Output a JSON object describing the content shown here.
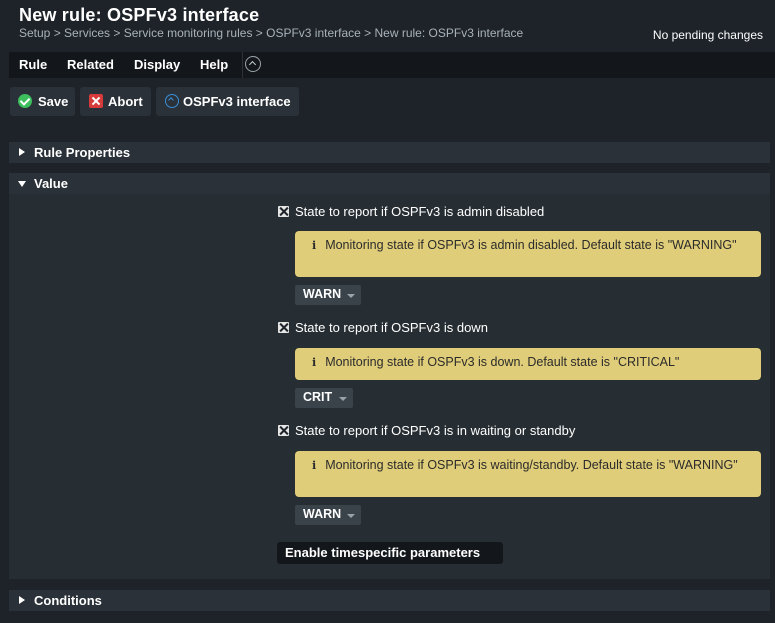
{
  "header": {
    "title": "New rule: OSPFv3 interface",
    "breadcrumb": "Setup > Services > Service monitoring rules > OSPFv3 interface > New rule: OSPFv3 interface",
    "pending": "No pending changes"
  },
  "menu": {
    "rule": "Rule",
    "related": "Related",
    "display": "Display",
    "help": "Help"
  },
  "toolbar": {
    "save": "Save",
    "abort": "Abort",
    "ospf": "OSPFv3 interface"
  },
  "sections": {
    "rule_properties": "Rule Properties",
    "value": "Value",
    "conditions": "Conditions"
  },
  "value": {
    "items": [
      {
        "label": "State to report if OSPFv3 is admin disabled",
        "info": "Monitoring state if OSPFv3 is admin disabled. Default state is \"WARNING\"",
        "state": "WARN"
      },
      {
        "label": "State to report if OSPFv3 is down",
        "info": "Monitoring state if OSPFv3 is down. Default state is \"CRITICAL\"",
        "state": "CRIT"
      },
      {
        "label": "State to report if OSPFv3 is in waiting or standby",
        "info": "Monitoring state if OSPFv3 is waiting/standby. Default state is \"WARNING\"",
        "state": "WARN"
      }
    ],
    "timespecific": "Enable timespecific parameters"
  },
  "info_icon": "i",
  "colors": {
    "background": "#1e2329",
    "info_box": "#e0cd79",
    "save": "#3cbf5c",
    "abort": "#d63a3a",
    "link": "#3a8fd8"
  }
}
